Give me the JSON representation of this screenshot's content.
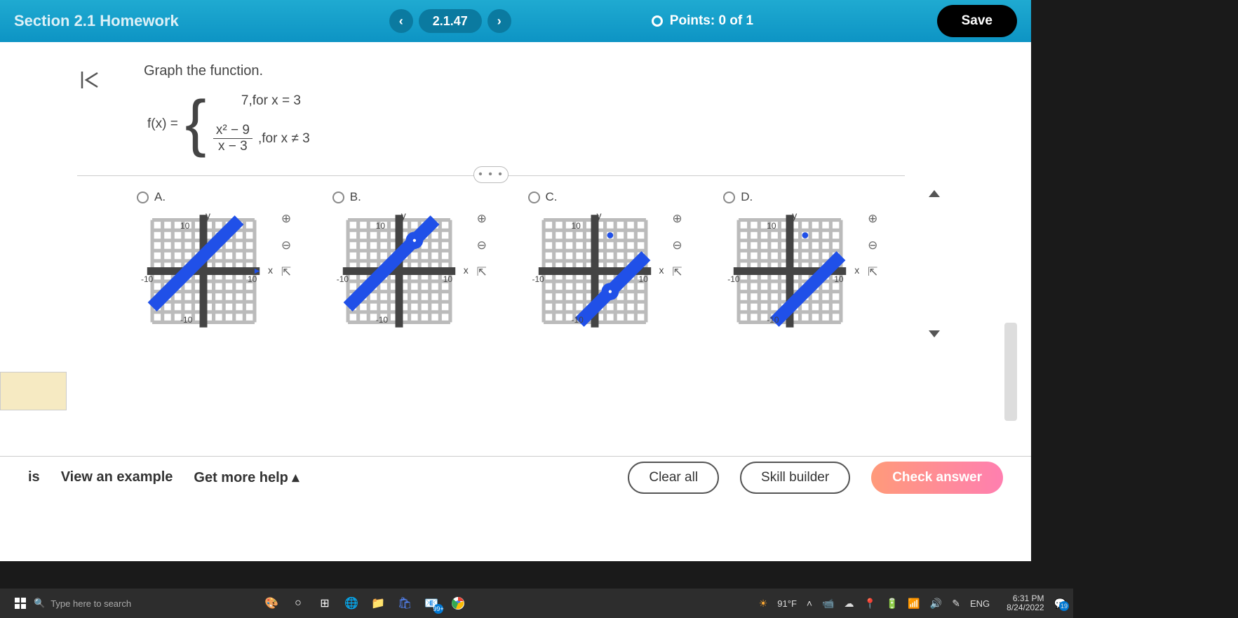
{
  "header": {
    "hw_title": "Section 2.1 Homework",
    "nav_prev": "‹",
    "nav_label": "2.1.47",
    "nav_next": "›",
    "points_label": "Points: 0 of 1",
    "save_label": "Save"
  },
  "problem": {
    "prompt": "Graph the function.",
    "fn_lhs": "f(x) =",
    "piece1_val": "7,",
    "piece1_cond": " for x = 3",
    "piece2_num": "x² − 9",
    "piece2_den": "x − 3",
    "piece2_sep": ",",
    "piece2_cond": " for x ≠ 3",
    "more_label": "• • •"
  },
  "options": {
    "a": "A.",
    "b": "B.",
    "c": "C.",
    "d": "D.",
    "y_label": "y",
    "x_label": "x",
    "tick_pos10": "10",
    "tick_neg10": "-10"
  },
  "tools": {
    "zoom_in": "⊕",
    "zoom_out": "⊖",
    "popout": "⇱"
  },
  "footer": {
    "is": "is",
    "view_example": "View an example",
    "get_help": "Get more help ▴",
    "clear_all": "Clear all",
    "skill_builder": "Skill builder",
    "check_answer": "Check answer"
  },
  "taskbar": {
    "search_placeholder": "Type here to search",
    "weather": "91°F",
    "lang": "ENG",
    "time": "6:31 PM",
    "date": "8/24/2022",
    "notif": "19",
    "badge99": "99+"
  }
}
